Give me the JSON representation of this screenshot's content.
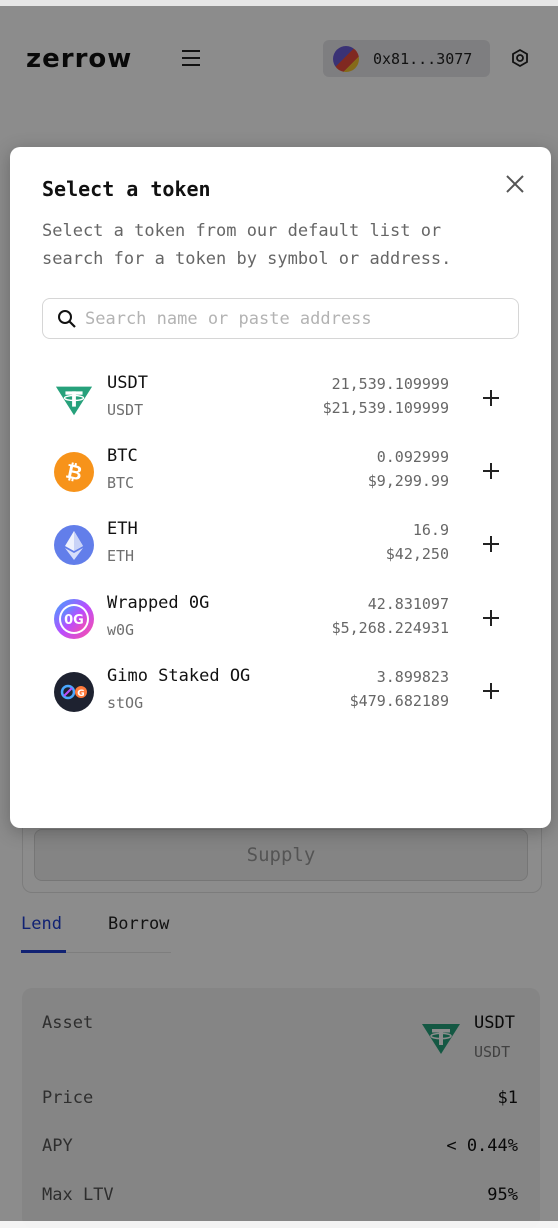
{
  "header": {
    "logo": "zerrow",
    "wallet_address": "0x81...3077"
  },
  "modal": {
    "title": "Select a token",
    "description": "Select a token from our default list or search for a token by symbol or address.",
    "search_placeholder": "Search name or paste address",
    "tokens": [
      {
        "name": "USDT",
        "symbol": "USDT",
        "balance": "21,539.109999",
        "usd": "$21,539.109999",
        "icon": "usdt-icon"
      },
      {
        "name": "BTC",
        "symbol": "BTC",
        "balance": "0.092999",
        "usd": "$9,299.99",
        "icon": "btc-icon"
      },
      {
        "name": "ETH",
        "symbol": "ETH",
        "balance": "16.9",
        "usd": "$42,250",
        "icon": "eth-icon"
      },
      {
        "name": "Wrapped 0G",
        "symbol": "w0G",
        "balance": "42.831097",
        "usd": "$5,268.224931",
        "icon": "w0g-icon"
      },
      {
        "name": "Gimo Staked OG",
        "symbol": "stOG",
        "balance": "3.899823",
        "usd": "$479.682189",
        "icon": "stog-icon"
      }
    ]
  },
  "main": {
    "supply_label": "Supply",
    "tabs": [
      {
        "label": "Lend",
        "active": true
      },
      {
        "label": "Borrow",
        "active": false
      }
    ],
    "info": {
      "asset_label": "Asset",
      "asset_symbol": "USDT",
      "asset_sub": "USDT",
      "price_label": "Price",
      "price_value": "$1",
      "apy_label": "APY",
      "apy_value": "< 0.44%",
      "ltv_label": "Max LTV",
      "ltv_value": "95%"
    }
  },
  "colors": {
    "accent": "#1f3fd1",
    "usdt": "#26a17b",
    "btc": "#f7931a",
    "eth": "#627eea"
  }
}
